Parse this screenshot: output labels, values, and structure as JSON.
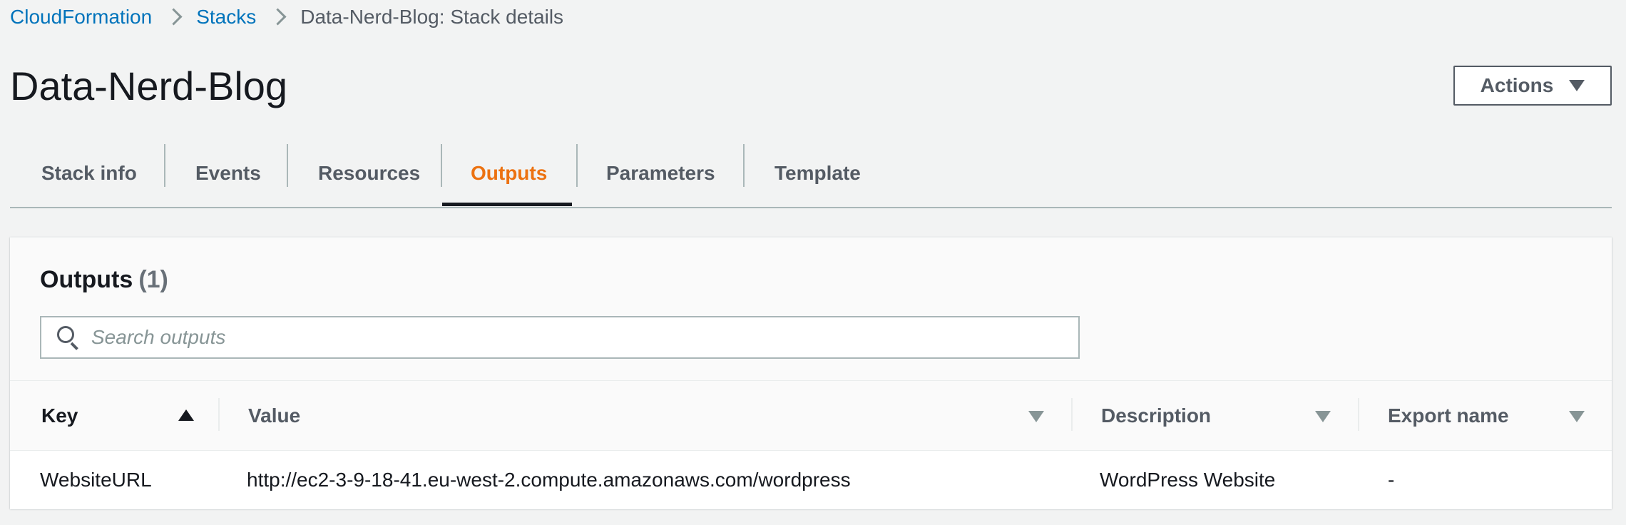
{
  "breadcrumb": {
    "items": [
      "CloudFormation",
      "Stacks"
    ],
    "current": "Data-Nerd-Blog: Stack details"
  },
  "page": {
    "title": "Data-Nerd-Blog",
    "actions_label": "Actions"
  },
  "tabs": [
    {
      "label": "Stack info",
      "active": false
    },
    {
      "label": "Events",
      "active": false
    },
    {
      "label": "Resources",
      "active": false
    },
    {
      "label": "Outputs",
      "active": true
    },
    {
      "label": "Parameters",
      "active": false
    },
    {
      "label": "Template",
      "active": false
    }
  ],
  "outputs": {
    "title": "Outputs",
    "count": "(1)",
    "search_placeholder": "Search outputs",
    "columns": [
      "Key",
      "Value",
      "Description",
      "Export name"
    ],
    "rows": [
      {
        "key": "WebsiteURL",
        "value": "http://ec2-3-9-18-41.eu-west-2.compute.amazonaws.com/wordpress",
        "description": "WordPress Website",
        "export_name": "-"
      }
    ]
  },
  "colors": {
    "link": "#0073bb",
    "active_tab": "#ec7211",
    "background": "#f2f3f3"
  }
}
